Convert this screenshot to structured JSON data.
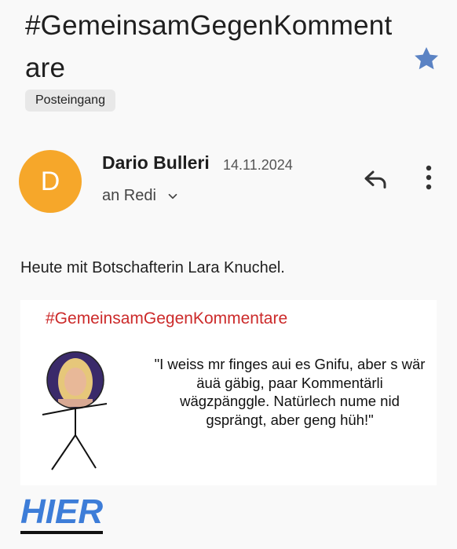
{
  "email": {
    "subject": "#GemeinsamGegenKommentare",
    "label": "Posteingang",
    "sender": {
      "initial": "D",
      "name": "Dario Bulleri",
      "date": "14.11.2024",
      "recipient": "an Redi",
      "avatar_color": "#f6a72a"
    },
    "body_text": "Heute mit Botschafterin Lara Knuchel.",
    "image_card": {
      "title": "#GemeinsamGegenKommentare",
      "quote": "\"I weiss mr finges aui es Gnifu, aber s wär äuä gäbig, paar Kommentärli wägzpänggle. Natürlech nume nid gsprängt, aber geng hüh!\""
    },
    "link_text": "HIER"
  },
  "colors": {
    "star": "#5b83c4",
    "card_title": "#cc2a2a",
    "link": "#3d7dd8"
  },
  "icons": [
    "star-icon",
    "reply-icon",
    "more-vert-icon",
    "chevron-down-icon"
  ]
}
